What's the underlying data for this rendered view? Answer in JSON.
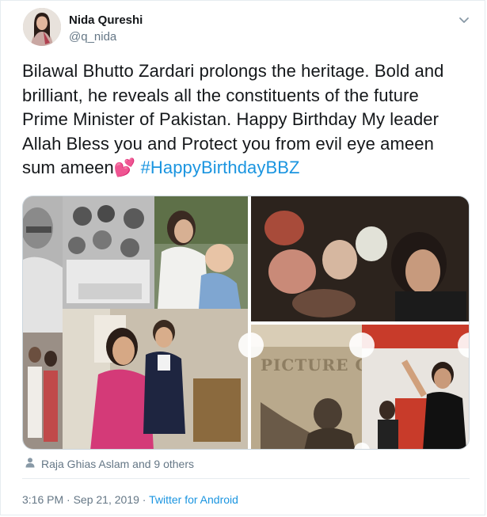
{
  "author": {
    "name": "Nida Qureshi",
    "handle": "@q_nida"
  },
  "tweet": {
    "text_lines": [
      "Bilawal Bhutto Zardari prolongs the heritage. Bold and",
      "brilliant, he reveals all the constituents of the future",
      "Prime Minister of Pakistan. Happy Birthday My leader",
      "Allah Bless you and Protect you from evil eye ameen",
      "sum ameen"
    ],
    "emoji": "💕",
    "hashtag": "#HappyBirthdayBBZ"
  },
  "media": {
    "watermark": "PICTURE CROUP"
  },
  "likes": {
    "text": "Raja Ghias Aslam and 9 others"
  },
  "meta": {
    "time": "3:16 PM",
    "separator1": " · ",
    "date": "Sep 21, 2019",
    "separator2": " · ",
    "source": "Twitter for Android"
  },
  "icons": {
    "caret": "chevron-down-icon",
    "person": "person-icon"
  },
  "colors": {
    "link": "#1b95e0",
    "secondary": "#657786",
    "text": "#14171a",
    "border": "#e6ecf0"
  }
}
